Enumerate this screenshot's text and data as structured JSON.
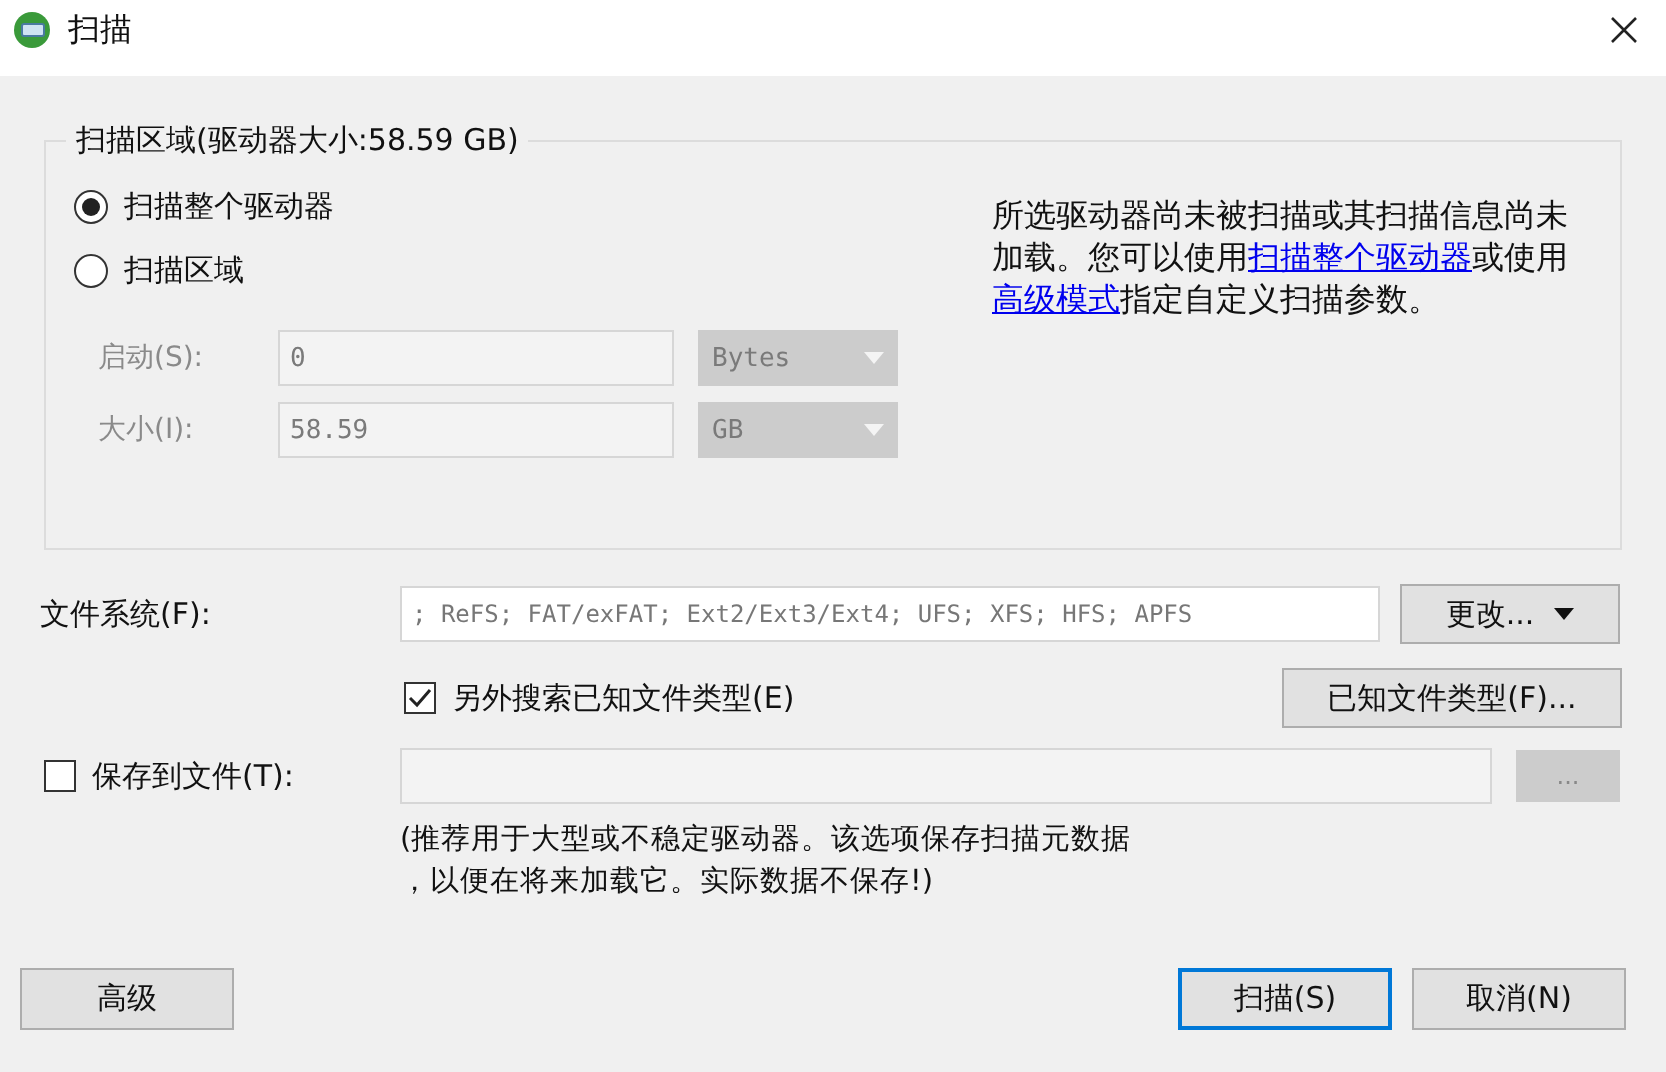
{
  "window": {
    "title": "扫描"
  },
  "scan_area": {
    "legend": "扫描区域(驱动器大小:58.59 GB)",
    "options": [
      {
        "label": "扫描整个驱动器",
        "selected": true
      },
      {
        "label": "扫描区域",
        "selected": false
      }
    ],
    "fields": [
      {
        "label": "启动(S):",
        "value": "0",
        "unit": "Bytes",
        "disabled": true
      },
      {
        "label": "大小(I):",
        "value": "58.59",
        "unit": "GB",
        "disabled": true
      }
    ],
    "info": [
      {
        "kind": "text",
        "text": "所选驱动器尚未被扫描或其扫描信息尚未加载。您可以使用"
      },
      {
        "kind": "link",
        "text": "扫描整个驱动器"
      },
      {
        "kind": "text",
        "text": "或使用"
      },
      {
        "kind": "link",
        "text": "高级模式"
      },
      {
        "kind": "text",
        "text": "指定自定义扫描参数。"
      }
    ]
  },
  "file_system": {
    "label": "文件系统(F):",
    "value": "; ReFS; FAT/exFAT; Ext2/Ext3/Ext4; UFS; XFS; HFS; APFS",
    "button": "更改..."
  },
  "known_types": {
    "label": "另外搜索已知文件类型(E)",
    "checked": true,
    "button": "已知文件类型(F)..."
  },
  "save_to_file": {
    "label": "保存到文件(T):",
    "checked": false,
    "button": "...",
    "note": [
      "(推荐用于大型或不稳定驱动器。该选项保存扫描元数据",
      "，以便在将来加载它。实际数据不保存!)"
    ]
  },
  "buttons": [
    {
      "label": "高级",
      "default": false
    },
    {
      "label": "扫描(S)",
      "default": true
    },
    {
      "label": "取消(N)",
      "default": false
    }
  ]
}
